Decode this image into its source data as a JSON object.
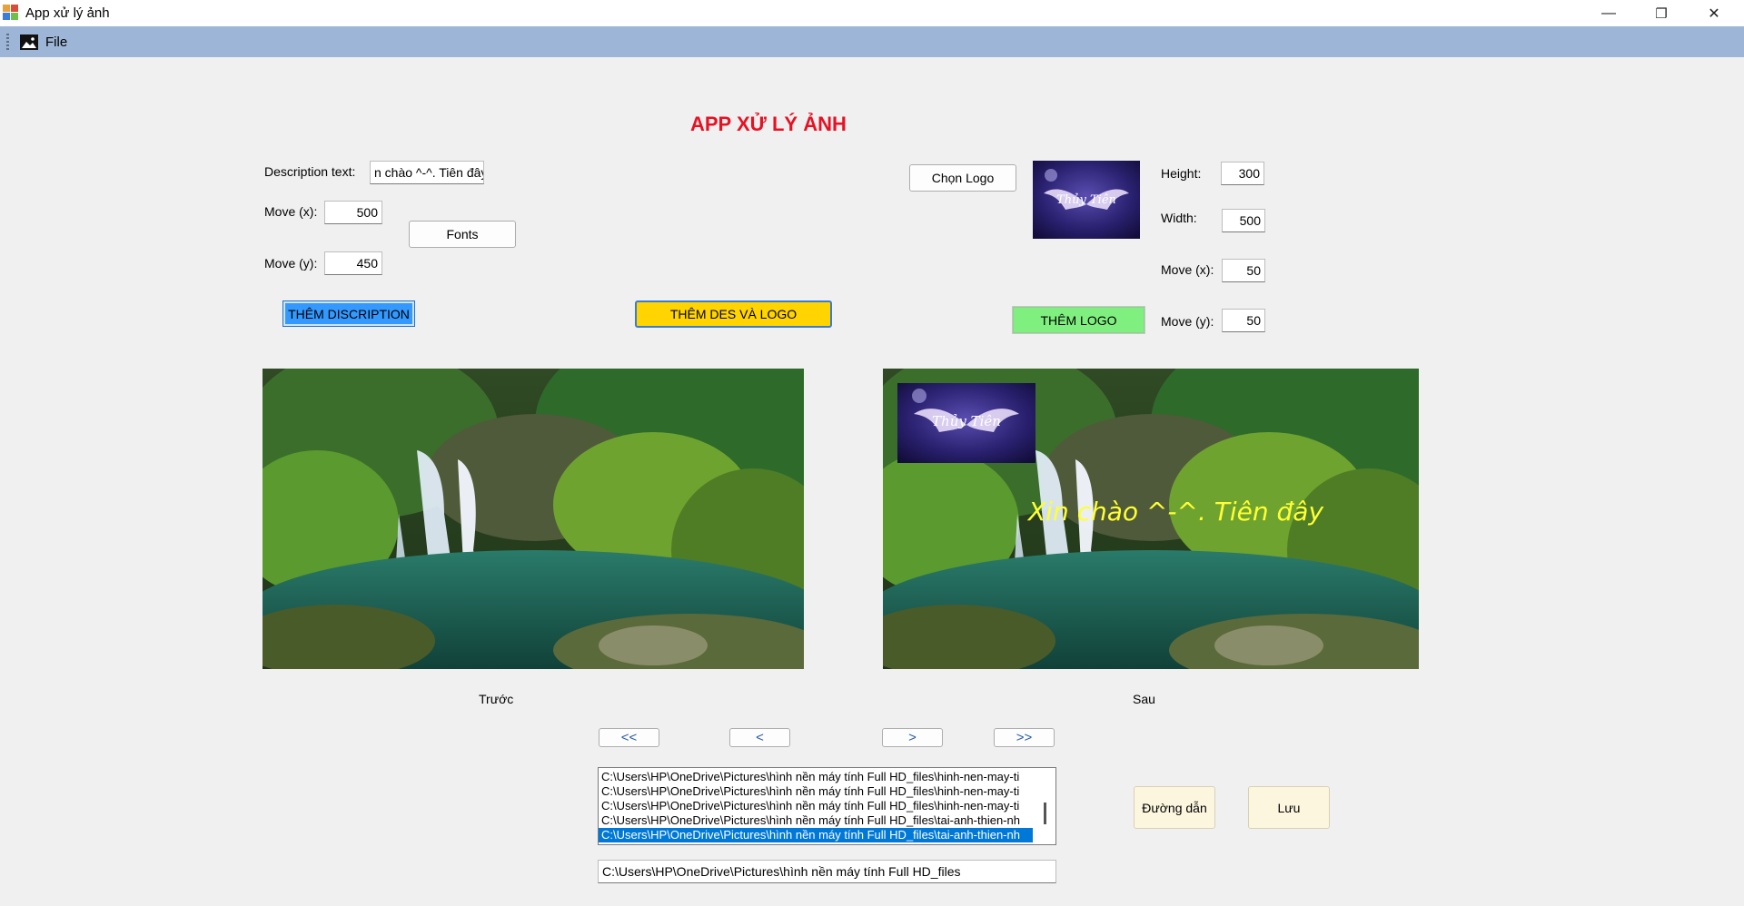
{
  "window": {
    "title": "App xử lý ảnh",
    "minimize_glyph": "—",
    "restore_glyph": "❐",
    "close_glyph": "✕"
  },
  "menu": {
    "file": "File",
    "file_icon": "image-icon"
  },
  "heading": "APP XỬ LÝ ẢNH",
  "description": {
    "label": "Description text:",
    "value": "n chào ^-^. Tiên đây",
    "move_x_label": "Move (x):",
    "move_x": "500",
    "move_y_label": "Move (y):",
    "move_y": "450",
    "fonts_button": "Fonts",
    "add_button": "THÊM DISCRIPTION"
  },
  "combined_button": "THÊM DES VÀ LOGO",
  "logo": {
    "choose_button": "Chọn Logo",
    "preview_text": "Thủy Tiên",
    "height_label": "Height:",
    "height": "300",
    "width_label": "Width:",
    "width": "500",
    "move_x_label": "Move (x):",
    "move_x": "50",
    "move_y_label": "Move (y):",
    "move_y": "50",
    "add_button": "THÊM LOGO"
  },
  "images": {
    "before_label": "Trước",
    "after_label": "Sau",
    "overlay_text": "Xin chào ^-^. Tiên đây",
    "logo_text": "Thủy Tiên"
  },
  "navigation": {
    "first": "<<",
    "prev": "<",
    "next": ">",
    "last": ">>"
  },
  "files": {
    "items": [
      "C:\\Users\\HP\\OneDrive\\Pictures\\hình nền máy tính Full HD_files\\hinh-nen-may-ti",
      "C:\\Users\\HP\\OneDrive\\Pictures\\hình nền máy tính Full HD_files\\hinh-nen-may-ti",
      "C:\\Users\\HP\\OneDrive\\Pictures\\hình nền máy tính Full HD_files\\hinh-nen-may-ti",
      "C:\\Users\\HP\\OneDrive\\Pictures\\hình nền máy tính Full HD_files\\tai-anh-thien-nh",
      "C:\\Users\\HP\\OneDrive\\Pictures\\hình nền máy tính Full HD_files\\tai-anh-thien-nh"
    ],
    "selected_index": 4,
    "path": "C:\\Users\\HP\\OneDrive\\Pictures\\hình nền máy tính Full HD_files",
    "path_button": "Đường dẫn",
    "save_button": "Lưu"
  },
  "colors": {
    "heading": "#e81123",
    "menubar": "#9db5d6",
    "add_description": "#3399ff",
    "add_combined": "#ffd400",
    "add_logo": "#7ff07f",
    "overlay_text": "#ffff33",
    "selection": "#0078d7"
  }
}
